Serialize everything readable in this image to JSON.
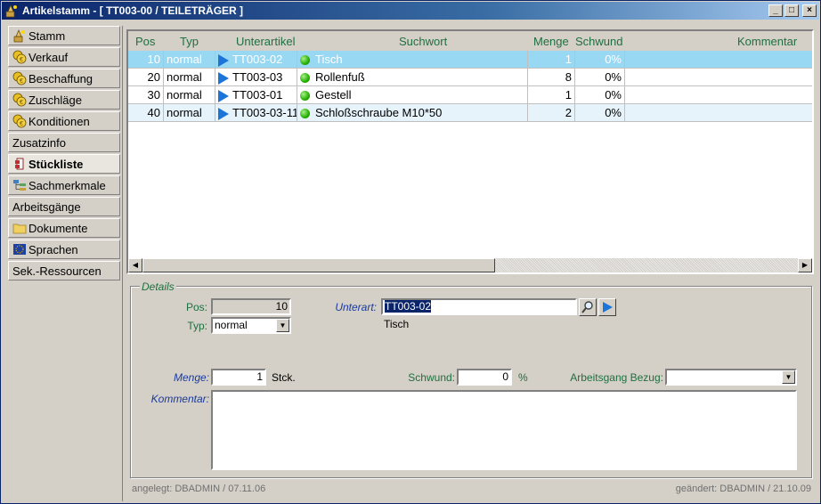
{
  "window": {
    "title": "Artikelstamm - [ TT003-00 / TEILETRÄGER ]",
    "controls": [
      "_",
      "□",
      "×"
    ]
  },
  "sidebar": {
    "items": [
      {
        "label": "Stamm",
        "icon": "wizard-icon"
      },
      {
        "label": "Verkauf",
        "icon": "coins-icon"
      },
      {
        "label": "Beschaffung",
        "icon": "coins-icon"
      },
      {
        "label": "Zuschläge",
        "icon": "coins-icon"
      },
      {
        "label": "Konditionen",
        "icon": "coins-icon"
      },
      {
        "label": "Zusatzinfo",
        "icon": ""
      },
      {
        "label": "Stückliste",
        "icon": "bom-icon",
        "active": true
      },
      {
        "label": "Sachmerkmale",
        "icon": "tree-icon"
      },
      {
        "label": "Arbeitsgänge",
        "icon": ""
      },
      {
        "label": "Dokumente",
        "icon": "folder-icon"
      },
      {
        "label": "Sprachen",
        "icon": "eu-flag-icon"
      },
      {
        "label": "Sek.-Ressourcen",
        "icon": ""
      }
    ]
  },
  "grid": {
    "headers": {
      "pos": "Pos",
      "typ": "Typ",
      "unterartikel": "Unterartikel",
      "suchwort": "Suchwort",
      "menge": "Menge",
      "schwund": "Schwund",
      "kommentar": "Kommentar"
    },
    "rows": [
      {
        "pos": "10",
        "typ": "normal",
        "unterartikel": "TT003-02",
        "suchwort": "Tisch",
        "menge": "1",
        "schwund": "0%"
      },
      {
        "pos": "20",
        "typ": "normal",
        "unterartikel": "TT003-03",
        "suchwort": "Rollenfuß",
        "menge": "8",
        "schwund": "0%"
      },
      {
        "pos": "30",
        "typ": "normal",
        "unterartikel": "TT003-01",
        "suchwort": "Gestell",
        "menge": "1",
        "schwund": "0%"
      },
      {
        "pos": "40",
        "typ": "normal",
        "unterartikel": "TT003-03-11",
        "suchwort": "Schloßschraube M10*50",
        "menge": "2",
        "schwund": "0%"
      }
    ]
  },
  "details": {
    "legend": "Details",
    "pos_label": "Pos:",
    "pos_value": "10",
    "typ_label": "Typ:",
    "typ_value": "normal",
    "unterart_label": "Unterart:",
    "unterart_value": "TT003-02",
    "unterart_desc": "Tisch",
    "menge_label": "Menge:",
    "menge_value": "1",
    "menge_unit": "Stck.",
    "schwund_label": "Schwund:",
    "schwund_value": "0",
    "schwund_unit": "%",
    "arbeitsgang_label": "Arbeitsgang Bezug:",
    "arbeitsgang_value": "",
    "kommentar_label": "Kommentar:",
    "kommentar_value": ""
  },
  "footer": {
    "created": "angelegt: DBADMIN / 07.11.06",
    "changed": "geändert: DBADMIN / 21.10.09"
  }
}
